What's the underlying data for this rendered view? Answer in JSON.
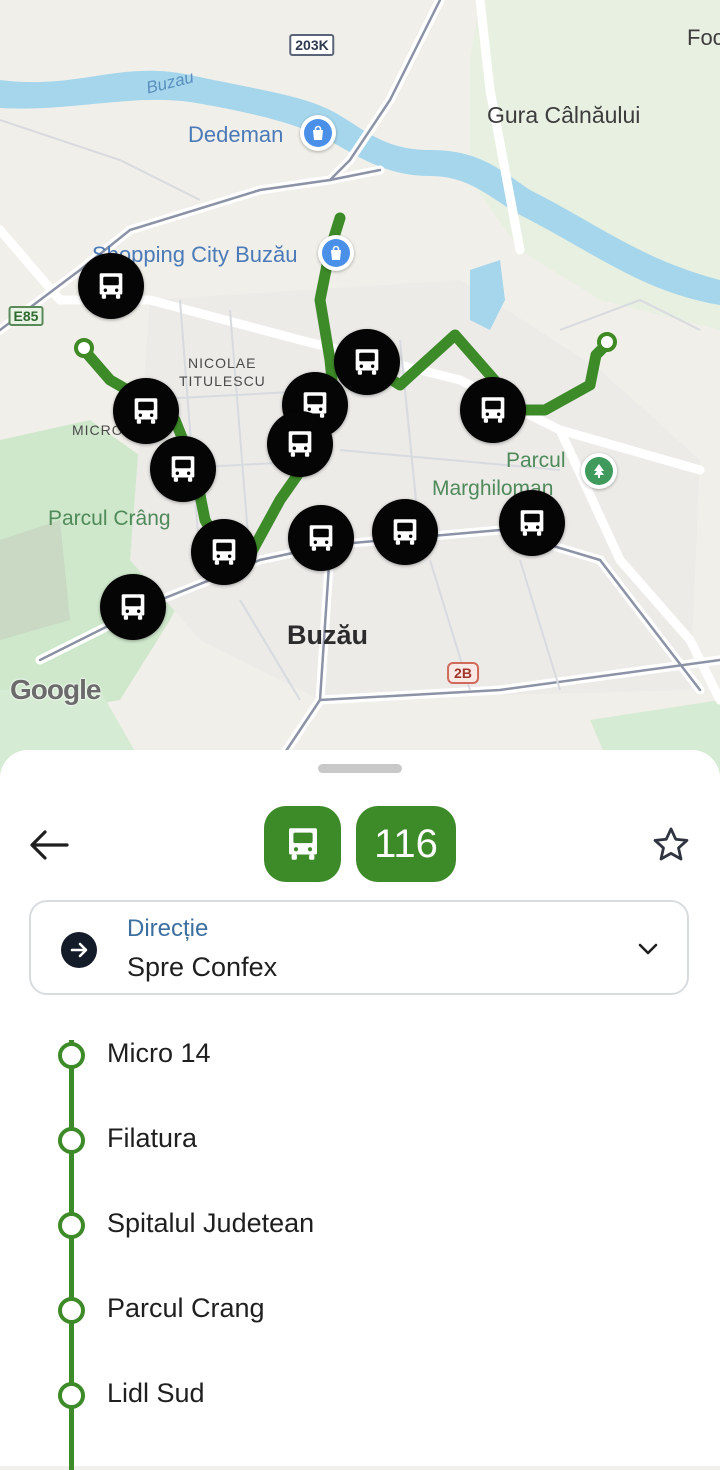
{
  "map": {
    "labels": {
      "river": "Buzau",
      "dedeman": "Dedeman",
      "shopping_city": "Shopping City Buzău",
      "gura": "Gura Câlnăului",
      "foc": "Foc",
      "nicolae": "NICOLAE",
      "titulescu": "TITULESCU",
      "micro": "MICRO",
      "parcul_crang": "Parcul Crâng",
      "parcul": "Parcul",
      "marghiloman": "Marghiloman",
      "city": "Buzău",
      "google": "Google"
    },
    "road_shields": {
      "r203k": "203K",
      "e85": "E85",
      "r2b": "2B"
    },
    "icons": {
      "bus_marker": "bus-icon",
      "shop_pin": "shopping-bag-icon",
      "park_pin": "tree-icon"
    }
  },
  "header": {
    "route_number": "116",
    "route_icon": "bus-icon",
    "back_icon": "arrow-left-icon",
    "favorite_icon": "star-outline-icon"
  },
  "direction": {
    "label": "Direcție",
    "value": "Spre Confex"
  },
  "stops": [
    {
      "name": "Micro 14"
    },
    {
      "name": "Filatura"
    },
    {
      "name": "Spitalul Judetean"
    },
    {
      "name": "Parcul Crang"
    },
    {
      "name": "Lidl Sud"
    }
  ],
  "colors": {
    "route_green": "#3d8b28",
    "direction_label": "#3d6fa0",
    "bus_marker": "#050505"
  }
}
